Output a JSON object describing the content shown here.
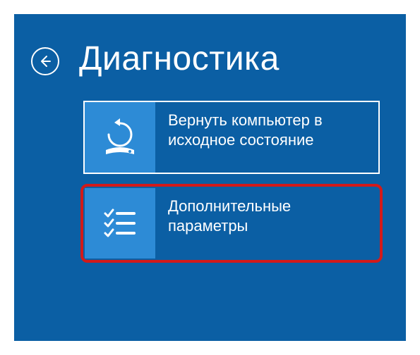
{
  "header": {
    "title": "Диагностика"
  },
  "options": [
    {
      "label": "Вернуть компьютер в исходное состояние",
      "icon": "reset-icon",
      "focused": true,
      "highlighted": false
    },
    {
      "label": "Дополнительные параметры",
      "icon": "advanced-options-icon",
      "focused": false,
      "highlighted": true
    }
  ],
  "colors": {
    "background": "#0b5fa4",
    "tile": "#2d8bd6",
    "highlight": "#d21a1a",
    "text": "#ffffff"
  }
}
